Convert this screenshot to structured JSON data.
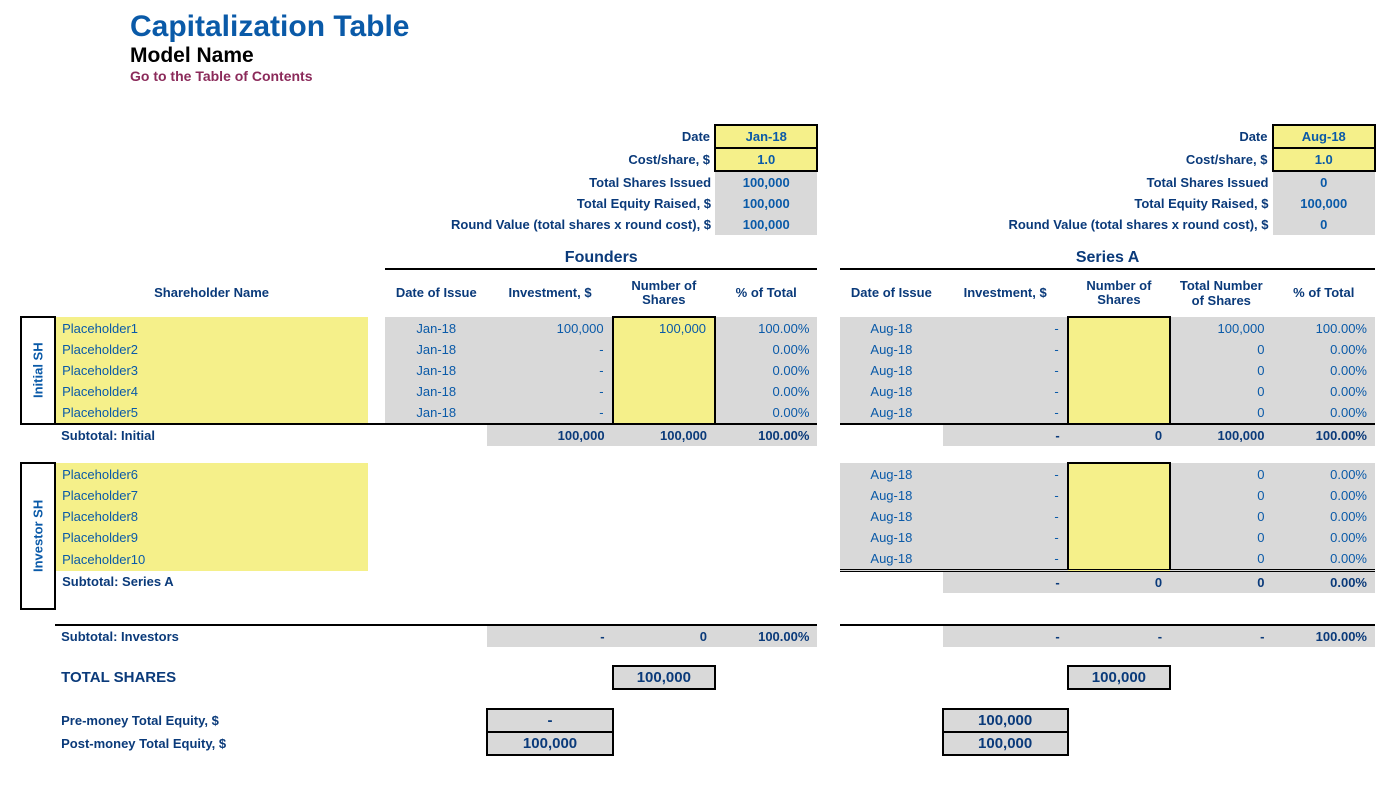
{
  "header": {
    "title": "Capitalization Table",
    "subtitle": "Model Name",
    "toc": "Go to the Table of Contents"
  },
  "labels": {
    "date": "Date",
    "cost_share": "Cost/share, $",
    "tsi": "Total Shares Issued",
    "ter": "Total Equity Raised, $",
    "rv": "Round Value (total shares x round cost), $",
    "shareholder": "Shareholder Name",
    "doi": "Date of Issue",
    "inv": "Investment, $",
    "nos": "Number of Shares",
    "tnos": "Total Number of Shares",
    "pct": "% of Total",
    "subtotal_initial": "Subtotal: Initial",
    "subtotal_seriesa": "Subtotal: Series A",
    "subtotal_investors": "Subtotal: Investors",
    "total_shares": "TOTAL SHARES",
    "pre_money": "Pre-money Total Equity, $",
    "post_money": "Post-money Total Equity, $",
    "initial_sh": "Initial SH",
    "investor_sh": "Investor SH",
    "founders": "Founders",
    "seriesa": "Series A"
  },
  "founders_summary": {
    "date": "Jan-18",
    "cost": "1.0",
    "tsi": "100,000",
    "ter": "100,000",
    "rv": "100,000"
  },
  "seriesa_summary": {
    "date": "Aug-18",
    "cost": "1.0",
    "tsi": "0",
    "ter": "100,000",
    "rv": "0"
  },
  "initial": [
    {
      "name": "Placeholder1",
      "f_doi": "Jan-18",
      "f_inv": "100,000",
      "f_nos": "100,000",
      "f_pct": "100.00%",
      "a_doi": "Aug-18",
      "a_inv": "-",
      "a_nos": "",
      "a_tnos": "100,000",
      "a_pct": "100.00%"
    },
    {
      "name": "Placeholder2",
      "f_doi": "Jan-18",
      "f_inv": "-",
      "f_nos": "",
      "f_pct": "0.00%",
      "a_doi": "Aug-18",
      "a_inv": "-",
      "a_nos": "",
      "a_tnos": "0",
      "a_pct": "0.00%"
    },
    {
      "name": "Placeholder3",
      "f_doi": "Jan-18",
      "f_inv": "-",
      "f_nos": "",
      "f_pct": "0.00%",
      "a_doi": "Aug-18",
      "a_inv": "-",
      "a_nos": "",
      "a_tnos": "0",
      "a_pct": "0.00%"
    },
    {
      "name": "Placeholder4",
      "f_doi": "Jan-18",
      "f_inv": "-",
      "f_nos": "",
      "f_pct": "0.00%",
      "a_doi": "Aug-18",
      "a_inv": "-",
      "a_nos": "",
      "a_tnos": "0",
      "a_pct": "0.00%"
    },
    {
      "name": "Placeholder5",
      "f_doi": "Jan-18",
      "f_inv": "-",
      "f_nos": "",
      "f_pct": "0.00%",
      "a_doi": "Aug-18",
      "a_inv": "-",
      "a_nos": "",
      "a_tnos": "0",
      "a_pct": "0.00%"
    }
  ],
  "sub_initial": {
    "f_inv": "100,000",
    "f_nos": "100,000",
    "f_pct": "100.00%",
    "a_inv": "-",
    "a_nos": "0",
    "a_tnos": "100,000",
    "a_pct": "100.00%"
  },
  "investors": [
    {
      "name": "Placeholder6",
      "a_doi": "Aug-18",
      "a_inv": "-",
      "a_nos": "",
      "a_tnos": "0",
      "a_pct": "0.00%"
    },
    {
      "name": "Placeholder7",
      "a_doi": "Aug-18",
      "a_inv": "-",
      "a_nos": "",
      "a_tnos": "0",
      "a_pct": "0.00%"
    },
    {
      "name": "Placeholder8",
      "a_doi": "Aug-18",
      "a_inv": "-",
      "a_nos": "",
      "a_tnos": "0",
      "a_pct": "0.00%"
    },
    {
      "name": "Placeholder9",
      "a_doi": "Aug-18",
      "a_inv": "-",
      "a_nos": "",
      "a_tnos": "0",
      "a_pct": "0.00%"
    },
    {
      "name": "Placeholder10",
      "a_doi": "Aug-18",
      "a_inv": "-",
      "a_nos": "",
      "a_tnos": "0",
      "a_pct": "0.00%"
    }
  ],
  "sub_seriesa": {
    "a_inv": "-",
    "a_nos": "0",
    "a_tnos": "0",
    "a_pct": "0.00%"
  },
  "sub_investors": {
    "f_inv": "-",
    "f_nos": "0",
    "f_pct": "100.00%",
    "a_inv": "-",
    "a_nos": "-",
    "a_tnos": "-",
    "a_pct": "100.00%"
  },
  "totals": {
    "f_shares": "100,000",
    "a_shares": "100,000",
    "f_pre": "-",
    "f_post": "100,000",
    "a_pre": "100,000",
    "a_post": "100,000"
  }
}
